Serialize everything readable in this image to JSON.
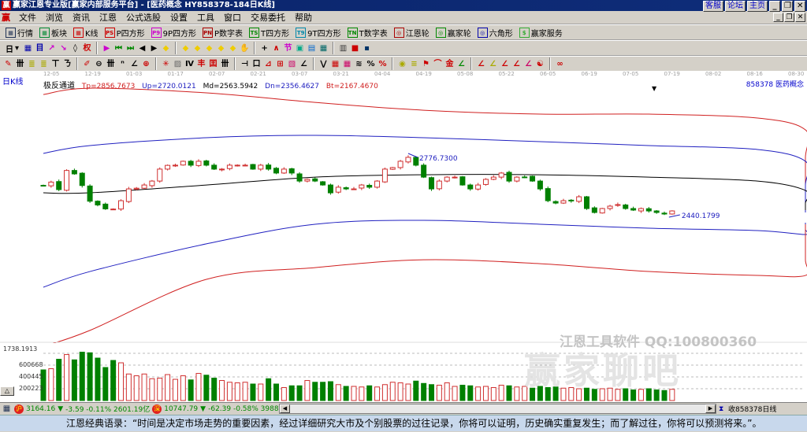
{
  "window": {
    "title": "赢家江恩专业版[赢家内部服务平台] - [医药概念   HY858378-184日K线]",
    "right_buttons": [
      "客服",
      "论坛",
      "主页"
    ]
  },
  "menu": [
    "文件",
    "浏览",
    "资讯",
    "江恩",
    "公式选股",
    "设置",
    "工具",
    "窗口",
    "交易委托",
    "帮助"
  ],
  "toolbar1": [
    {
      "icon": "quote-board-icon",
      "label": "行情",
      "c": "#235"
    },
    {
      "icon": "sector-icon",
      "label": "板块",
      "c": "#083"
    },
    {
      "icon": "kline-icon",
      "label": "K线",
      "c": "#c00"
    },
    {
      "icon": "p-square-icon",
      "label": "P四方形",
      "c": "#c00",
      "g": "PS"
    },
    {
      "icon": "9p-square-icon",
      "label": "9P四方形",
      "c": "#c0c",
      "g": "P9"
    },
    {
      "icon": "p-number-table-icon",
      "label": "P数字表",
      "c": "#a00",
      "g": "PN"
    },
    {
      "icon": "t-square-icon",
      "label": "T四方形",
      "c": "#080",
      "g": "TS"
    },
    {
      "icon": "9t-square-icon",
      "label": "9T四方形",
      "c": "#08a",
      "g": "T9"
    },
    {
      "icon": "t-number-table-icon",
      "label": "T数字表",
      "c": "#080",
      "g": "TN"
    },
    {
      "icon": "gann-wheel-icon",
      "label": "江恩轮",
      "c": "#a00",
      "g": "◎"
    },
    {
      "icon": "winner-wheel-icon",
      "label": "赢家轮",
      "c": "#080",
      "g": "◎"
    },
    {
      "icon": "hexagon-icon",
      "label": "六角形",
      "c": "#00a",
      "g": "◎"
    },
    {
      "icon": "dollar-icon",
      "label": "赢家服务",
      "c": "#3a3",
      "g": "$"
    }
  ],
  "toolbar2": {
    "period": "日",
    "icons": [
      [
        "chart-icon",
        "▦",
        "#00a"
      ],
      [
        "info-icon",
        "目",
        "#00a"
      ],
      [
        "up-trend-icon",
        "↗",
        "#c0c"
      ],
      [
        "down-trend-icon",
        "↘",
        "#c0c"
      ],
      [
        "candle-icon",
        "◊",
        "#000"
      ],
      [
        "rights-icon",
        "权",
        "#c00"
      ],
      [
        "flag-icon",
        "▶",
        "#c0c"
      ],
      [
        "first-icon",
        "⏮",
        "#080"
      ],
      [
        "last-icon",
        "⏭",
        "#080"
      ],
      [
        "left-icon",
        "◀",
        "#000"
      ],
      [
        "right-icon",
        "▶",
        "#000"
      ],
      [
        "diamond-1-icon",
        "◆",
        "#ec0"
      ],
      [
        "diamond-2-icon",
        "◆",
        "#ec0"
      ],
      [
        "diamond-3-icon",
        "◆",
        "#ec0"
      ],
      [
        "diamond-4-icon",
        "◆",
        "#ec0"
      ],
      [
        "diamond-5-icon",
        "◆",
        "#ec0"
      ],
      [
        "diamond-6-icon",
        "◆",
        "#ec0"
      ],
      [
        "hand-icon",
        "✋",
        "#000"
      ],
      [
        "cross-icon",
        "+",
        "#000"
      ],
      [
        "line-icon",
        "∧",
        "#c00"
      ],
      [
        "node-icon",
        "节",
        "#c0c"
      ],
      [
        "pattern-icon",
        "▣",
        "#0a8"
      ],
      [
        "calendar-icon",
        "▤",
        "#06c"
      ],
      [
        "calculator-icon",
        "▦",
        "#066"
      ],
      [
        "notes-icon",
        "▥",
        "#333"
      ],
      [
        "save-icon",
        "■",
        "#c00"
      ],
      [
        "truck-icon",
        "▪",
        "#036"
      ]
    ]
  },
  "toolbar3": {
    "icons": [
      [
        "pen-icon",
        "✎",
        "#c00"
      ],
      [
        "grid-icon",
        "卌",
        "#000"
      ],
      [
        "gold-1-icon",
        "≣",
        "#aa0"
      ],
      [
        "gold-2-icon",
        "≣",
        "#aa0"
      ],
      [
        "fork-icon",
        "ㄒ",
        "#000"
      ],
      [
        "wave-icon",
        "ㄋ",
        "#000"
      ],
      [
        "brush-icon",
        "✐",
        "#c00"
      ],
      [
        "circle-icon",
        "⊖",
        "#000"
      ],
      [
        "hash-icon",
        "卌",
        "#000"
      ],
      [
        "square-n-icon",
        "ⁿ",
        "#000"
      ],
      [
        "angle-icon",
        "∠",
        "#000"
      ],
      [
        "target-icon",
        "⊕",
        "#c00"
      ],
      [
        "star-icon",
        "✳",
        "#c00"
      ],
      [
        "box-icon",
        "▨",
        "#666"
      ],
      [
        "bracket-icon",
        "Ⅳ",
        "#000"
      ],
      [
        "fan-red-icon",
        "丰",
        "#c00"
      ],
      [
        "fan-box-icon",
        "囯",
        "#c00"
      ],
      [
        "lines-icon",
        "卌",
        "#000"
      ],
      [
        "measure-icon",
        "⊣",
        "#000"
      ],
      [
        "rect-icon",
        "口",
        "#000"
      ],
      [
        "ray-icon",
        "⊿",
        "#c00"
      ],
      [
        "net-icon",
        "⊞",
        "#c00"
      ],
      [
        "fib-icon",
        "▧",
        "#c06"
      ],
      [
        "angles-icon",
        "∠",
        "#000"
      ],
      [
        "zigzag-icon",
        "⋁",
        "#000"
      ],
      [
        "hatch-1-icon",
        "▦",
        "#c00"
      ],
      [
        "hatch-2-icon",
        "▦",
        "#c06"
      ],
      [
        "wave2-icon",
        "≋",
        "#000"
      ],
      [
        "percent-icon",
        "%",
        "#000"
      ],
      [
        "percent-line-icon",
        "%",
        "#c00"
      ],
      [
        "gold-coin-icon",
        "◉",
        "#aa0"
      ],
      [
        "gold-lines-icon",
        "≡",
        "#aa0"
      ],
      [
        "flag-line-icon",
        "⚑",
        "#c00"
      ],
      [
        "arc-icon",
        "⌒",
        "#c00"
      ],
      [
        "gold-fan-icon",
        "金",
        "#c00"
      ],
      [
        "fan-1-icon",
        "∠",
        "#080"
      ],
      [
        "fan-2-icon",
        "∠",
        "#c00"
      ],
      [
        "fan-3-icon",
        "∠",
        "#aa0"
      ],
      [
        "fan-4-icon",
        "∠",
        "#c00"
      ],
      [
        "fan-5-icon",
        "∠",
        "#c00"
      ],
      [
        "fan-6-icon",
        "∠",
        "#c06"
      ],
      [
        "yinyang-icon",
        "☯",
        "#c00"
      ],
      [
        "infinity-icon",
        "∞",
        "#c00"
      ]
    ]
  },
  "chart": {
    "period_label": "日K线",
    "indicator": "极反通道",
    "tp": "Tp=2856.7673",
    "up": "Up=2720.0121",
    "md": "Md=2563.5942",
    "dn": "Dn=2356.4627",
    "bt": "Bt=2167.4670",
    "code": "858378  医药概念",
    "dates": [
      "12-05",
      "12-19",
      "01-03",
      "01-17",
      "02-07",
      "02-21",
      "03-07",
      "03-21",
      "04-04",
      "04-19",
      "05-08",
      "05-22",
      "06-05",
      "06-19",
      "07-05",
      "07-19",
      "08-02",
      "08-16",
      "08-30"
    ],
    "high_label": "2776.7300",
    "low_label": "2440.1799",
    "volume_labels": [
      "1738.1913",
      "600668",
      "400445",
      "200223"
    ],
    "watermark": "江恩工具软件  QQ:100800360",
    "watermark2": "赢家聊吧",
    "colors": {
      "tp": "#d02020",
      "up": "#2020c0",
      "md": "#000000",
      "dn": "#2020c0",
      "bt": "#d02020",
      "rise": "#d03030",
      "fall": "#008000"
    }
  },
  "chart_data": {
    "type": "candlestick",
    "closes": [
      2610,
      2632,
      2588,
      2700,
      2680,
      2612,
      2520,
      2498,
      2475,
      2474,
      2523,
      2592,
      2596,
      2615,
      2638,
      2708,
      2730,
      2731,
      2754,
      2731,
      2754,
      2731,
      2708,
      2708,
      2731,
      2731,
      2731,
      2708,
      2731,
      2708,
      2685,
      2708,
      2685,
      2638,
      2648,
      2638,
      2615,
      2569,
      2602,
      2592,
      2592,
      2615,
      2602,
      2638,
      2708,
      2717,
      2754,
      2777,
      2731,
      2661,
      2592,
      2638,
      2661,
      2661,
      2615,
      2592,
      2615,
      2648,
      2661,
      2685,
      2638,
      2661,
      2661,
      2638,
      2592,
      2523,
      2509,
      2523,
      2523,
      2546,
      2477,
      2454,
      2477,
      2491,
      2500,
      2477,
      2468,
      2477,
      2463,
      2454,
      2445,
      2463
    ],
    "volume": [
      520000,
      540000,
      700000,
      780000,
      690000,
      820000,
      810000,
      720000,
      560000,
      680000,
      640000,
      450000,
      420000,
      450000,
      370000,
      380000,
      440000,
      360000,
      420000,
      350000,
      460000,
      430000,
      380000,
      340000,
      310000,
      300000,
      310000,
      280000,
      280000,
      370000,
      280000,
      220000,
      250000,
      250000,
      340000,
      310000,
      310000,
      320000,
      270000,
      240000,
      240000,
      230000,
      250000,
      230000,
      270000,
      310000,
      300000,
      280000,
      330000,
      290000,
      270000,
      260000,
      300000,
      240000,
      260000,
      250000,
      230000,
      240000,
      220000,
      260000,
      250000,
      230000,
      240000,
      210000,
      240000,
      220000,
      230000,
      210000,
      220000,
      200000,
      210000,
      190000,
      200000,
      210000,
      190000,
      200000,
      180000,
      190000,
      200000,
      180000,
      170000,
      190000
    ],
    "bands": {
      "index": [
        0,
        6,
        21,
        35,
        49,
        64,
        78,
        92,
        106,
        121,
        138
      ],
      "tp": [
        3145,
        3182,
        3155,
        3099,
        3053,
        3030,
        3030,
        3007,
        2938,
        2777,
        2569
      ],
      "up": [
        2800,
        2846,
        2892,
        2906,
        2892,
        2869,
        2846,
        2823,
        2754,
        2615,
        2454
      ],
      "md": [
        2569,
        2569,
        2615,
        2661,
        2675,
        2675,
        2661,
        2638,
        2583,
        2509,
        2468
      ],
      "dn": [
        2016,
        2108,
        2270,
        2385,
        2408,
        2385,
        2362,
        2348,
        2325,
        2353,
        2394
      ],
      "bt": [
        1670,
        1763,
        2062,
        2131,
        2177,
        2154,
        2108,
        2085,
        2085,
        2177,
        2385
      ]
    },
    "high": 2776.73,
    "low": 2440.18
  },
  "status": {
    "sh_badge": "沪",
    "sh_quote": "3164.16",
    "sh_arrow": "▼",
    "sh_change": "-3.59 -0.11% 2601.19亿",
    "sz_badge": "深",
    "sz_quote": "10747.79",
    "sz_arrow": "▼",
    "sz_change": "-62.39 -0.58% 3988.0",
    "right": "收858378日线"
  },
  "quote": "江恩经典语录：“时间是决定市场走势的重要因素，经过详细研究大市及个别股票的过往记录，你将可以证明，历史确实重复发生；而了解过往，你将可以预测将来。”。"
}
